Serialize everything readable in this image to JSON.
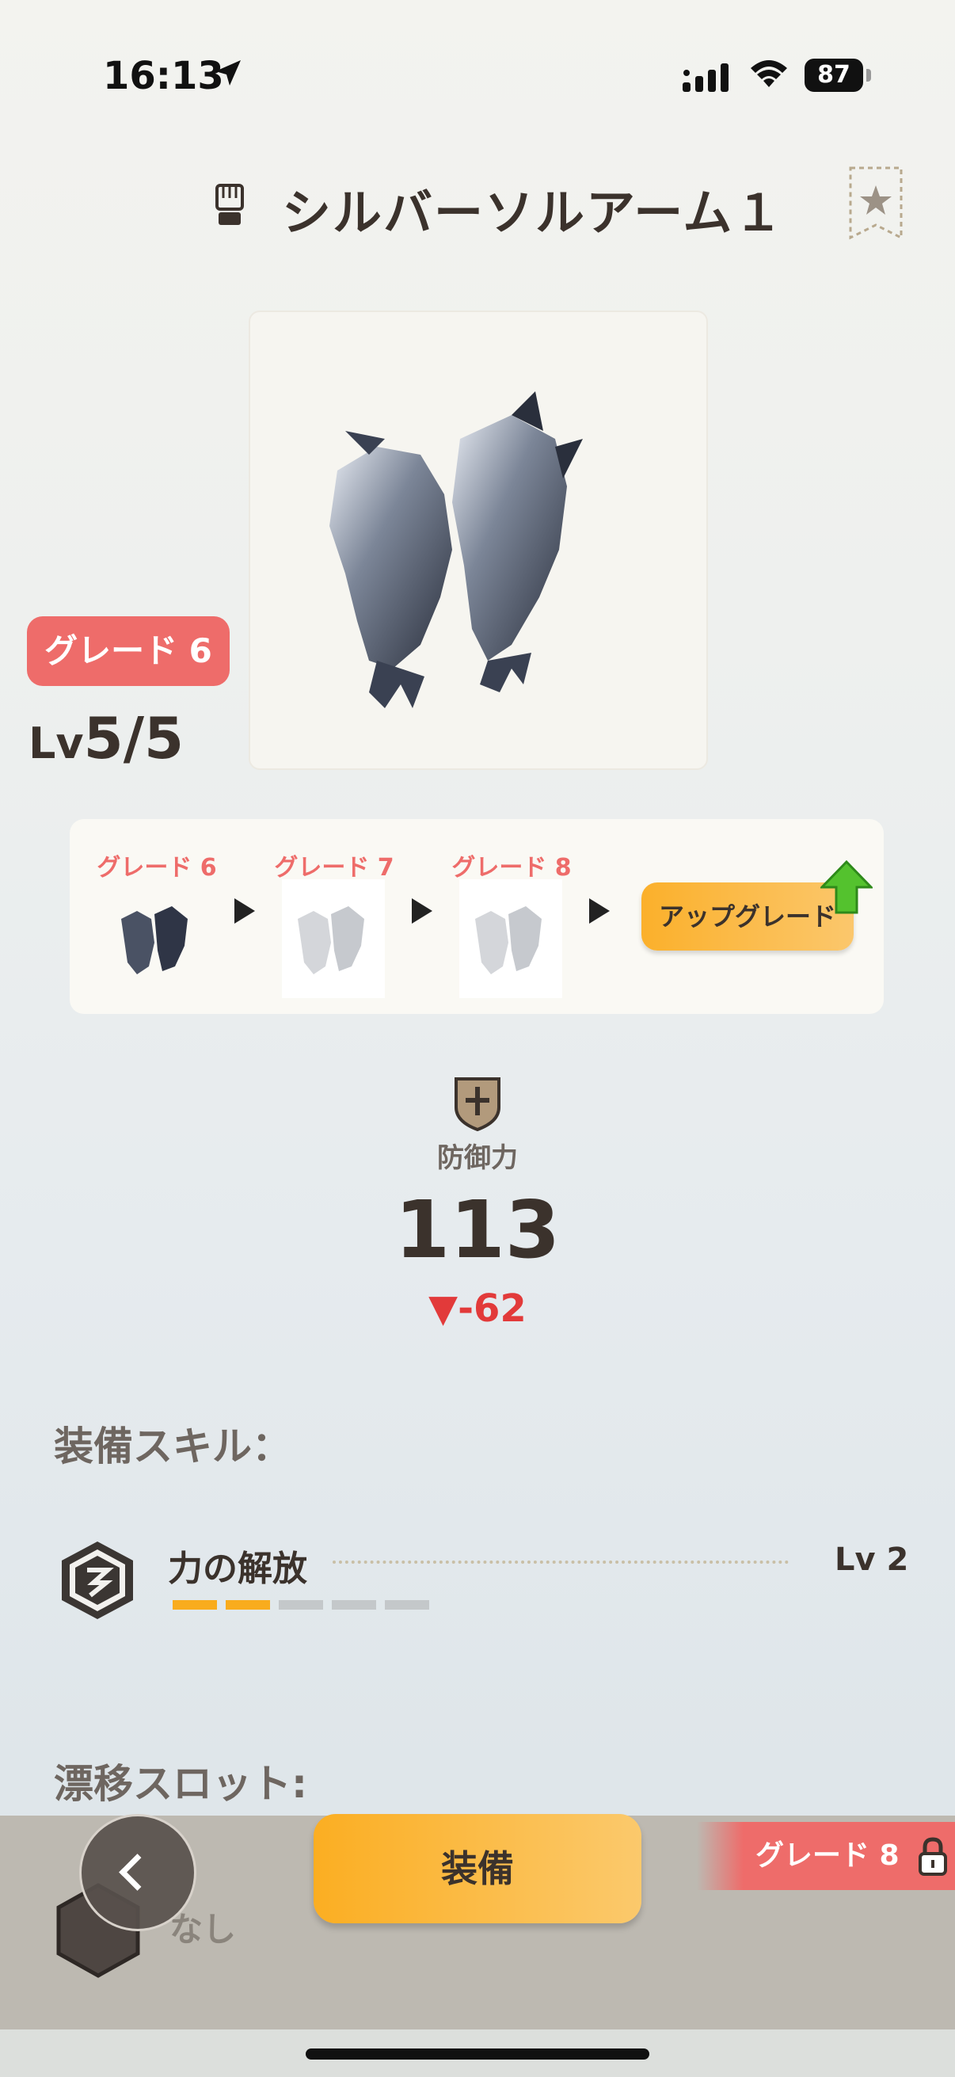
{
  "status_bar": {
    "time": "16:13",
    "battery": "87"
  },
  "header": {
    "title": "シルバーソルアーム１",
    "icon": "gauntlet-icon",
    "bookmark_icon": "star-bookmark-icon"
  },
  "item": {
    "grade_badge": "グレード 6",
    "level_prefix": "Lv",
    "level_value": "5/5"
  },
  "grade_path": {
    "steps": [
      {
        "label": "グレード 6",
        "unlocked": true
      },
      {
        "label": "グレード 7",
        "unlocked": false
      },
      {
        "label": "グレード 8",
        "unlocked": false
      }
    ],
    "upgrade_label": "アップグレード"
  },
  "stats": {
    "label": "防御力",
    "value": "113",
    "diff": "▼-62"
  },
  "skills": {
    "title": "装備スキル：",
    "items": [
      {
        "name": "力の解放",
        "level": "Lv 2",
        "filled": 2,
        "total": 5
      }
    ]
  },
  "drift": {
    "title": "漂移スロット:",
    "slot_text": "なし"
  },
  "actions": {
    "equip_label": "装備",
    "grade_lock_label": "グレード 8"
  },
  "colors": {
    "accent_orange": "#fbae22",
    "grade_red": "#ee6c6a",
    "text_dark": "#3b322c",
    "diff_red": "#e23a3a"
  }
}
